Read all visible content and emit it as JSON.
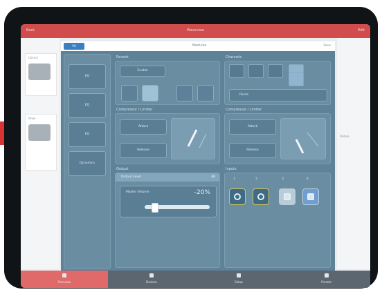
{
  "app": {
    "title": "Waveview",
    "back": "Back",
    "right": "Edit"
  },
  "background": {
    "card1_label": "Library",
    "card2_label": "Mixer",
    "right_label": "Details"
  },
  "modal": {
    "header_select": "VU",
    "header_title": "Modules",
    "header_right": "Done",
    "left_items": [
      "EQ",
      "EQ",
      "EQ",
      "Dynamics"
    ],
    "sec_a_title": "Reverb",
    "sec_a_button": "Enable",
    "sec_b_title": "Channels",
    "sec_b_button": "Route",
    "sec_c_title": "Compressor / Limiter",
    "sec_c_buttons": [
      "Attack",
      "Release"
    ],
    "sec_d_title": "Compressor / Limiter",
    "sec_d_buttons": [
      "Attack",
      "Release"
    ],
    "sec_e_title": "Output",
    "sec_e_header": "Output Level",
    "sec_e_header_value": "dB",
    "sec_e_label": "Master Volume",
    "sec_e_value": "-20%",
    "output_level_fraction": 0.15,
    "sec_f_title": "Inputs",
    "sec_f_labels": [
      "1",
      "2",
      "3",
      "4"
    ]
  },
  "bottom_nav": [
    {
      "label": "Overview",
      "icon": "home-icon"
    },
    {
      "label": "Devices",
      "icon": "devices-icon"
    },
    {
      "label": "Setup",
      "icon": "setup-icon"
    },
    {
      "label": "Presets",
      "icon": "presets-icon"
    }
  ],
  "colors": {
    "accent_red": "#d14d4d",
    "modal_bg": "#5e8298",
    "bottom_active": "#e06a6a"
  }
}
